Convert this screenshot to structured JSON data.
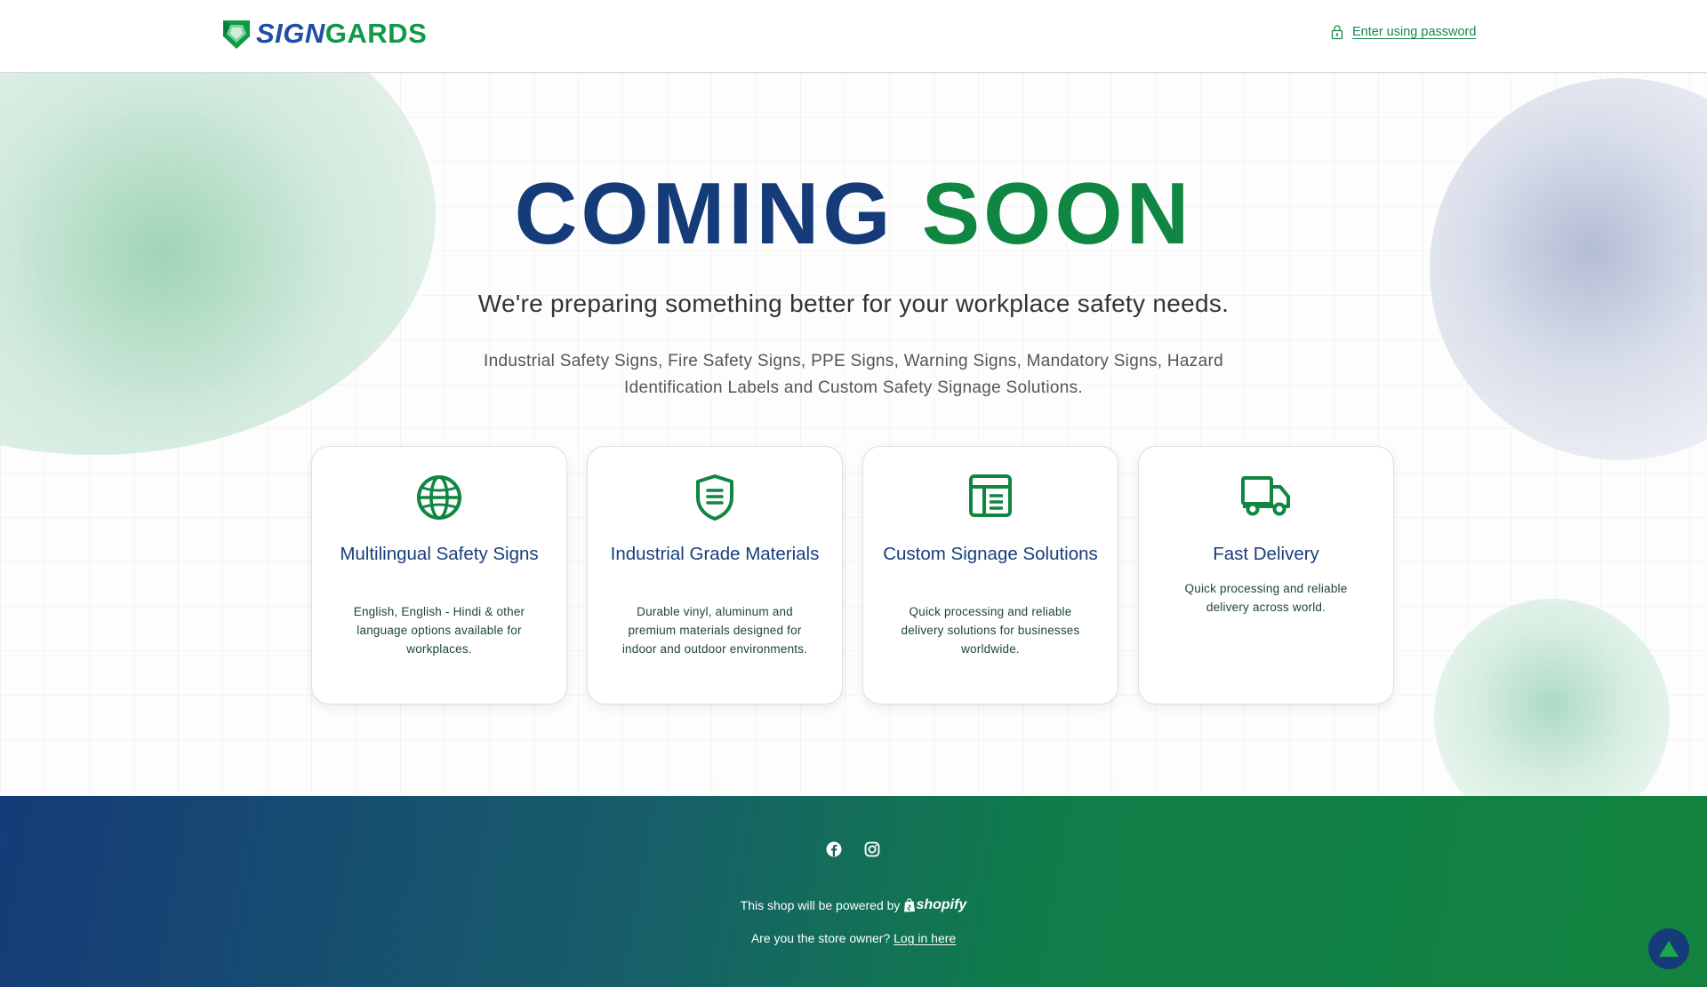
{
  "header": {
    "logo_sign": "SIGN",
    "logo_gards": "GARDS",
    "password_link": "Enter using password"
  },
  "hero": {
    "title_part1": "COMING",
    "title_part2": "SOON",
    "subtitle": "We're preparing something better for your workplace safety needs.",
    "description": "Industrial Safety Signs, Fire Safety Signs, PPE Signs, Warning Signs, Mandatory Signs, Hazard Identification Labels and Custom Safety Signage Solutions."
  },
  "features": [
    {
      "icon": "globe-icon",
      "title": "Multilingual Safety Signs",
      "text": "English, English - Hindi & other language options available for workplaces."
    },
    {
      "icon": "shield-icon",
      "title": "Industrial Grade Materials",
      "text": "Durable vinyl, aluminum and premium materials designed for indoor and outdoor environments."
    },
    {
      "icon": "layout-icon",
      "title": "Custom Signage Solutions",
      "text": "Quick processing and reliable delivery solutions for businesses worldwide."
    },
    {
      "icon": "truck-icon",
      "title": "Fast Delivery",
      "text": "Quick processing and reliable delivery across world."
    }
  ],
  "footer": {
    "social": [
      "facebook-icon",
      "instagram-icon"
    ],
    "powered_text": "This shop will be powered by",
    "shopify_label": "shopify",
    "owner_question": "Are you the store owner?",
    "login_link": "Log in here"
  },
  "colors": {
    "navy": "#163b79",
    "green": "#0f8641",
    "link_green": "#17894a"
  }
}
